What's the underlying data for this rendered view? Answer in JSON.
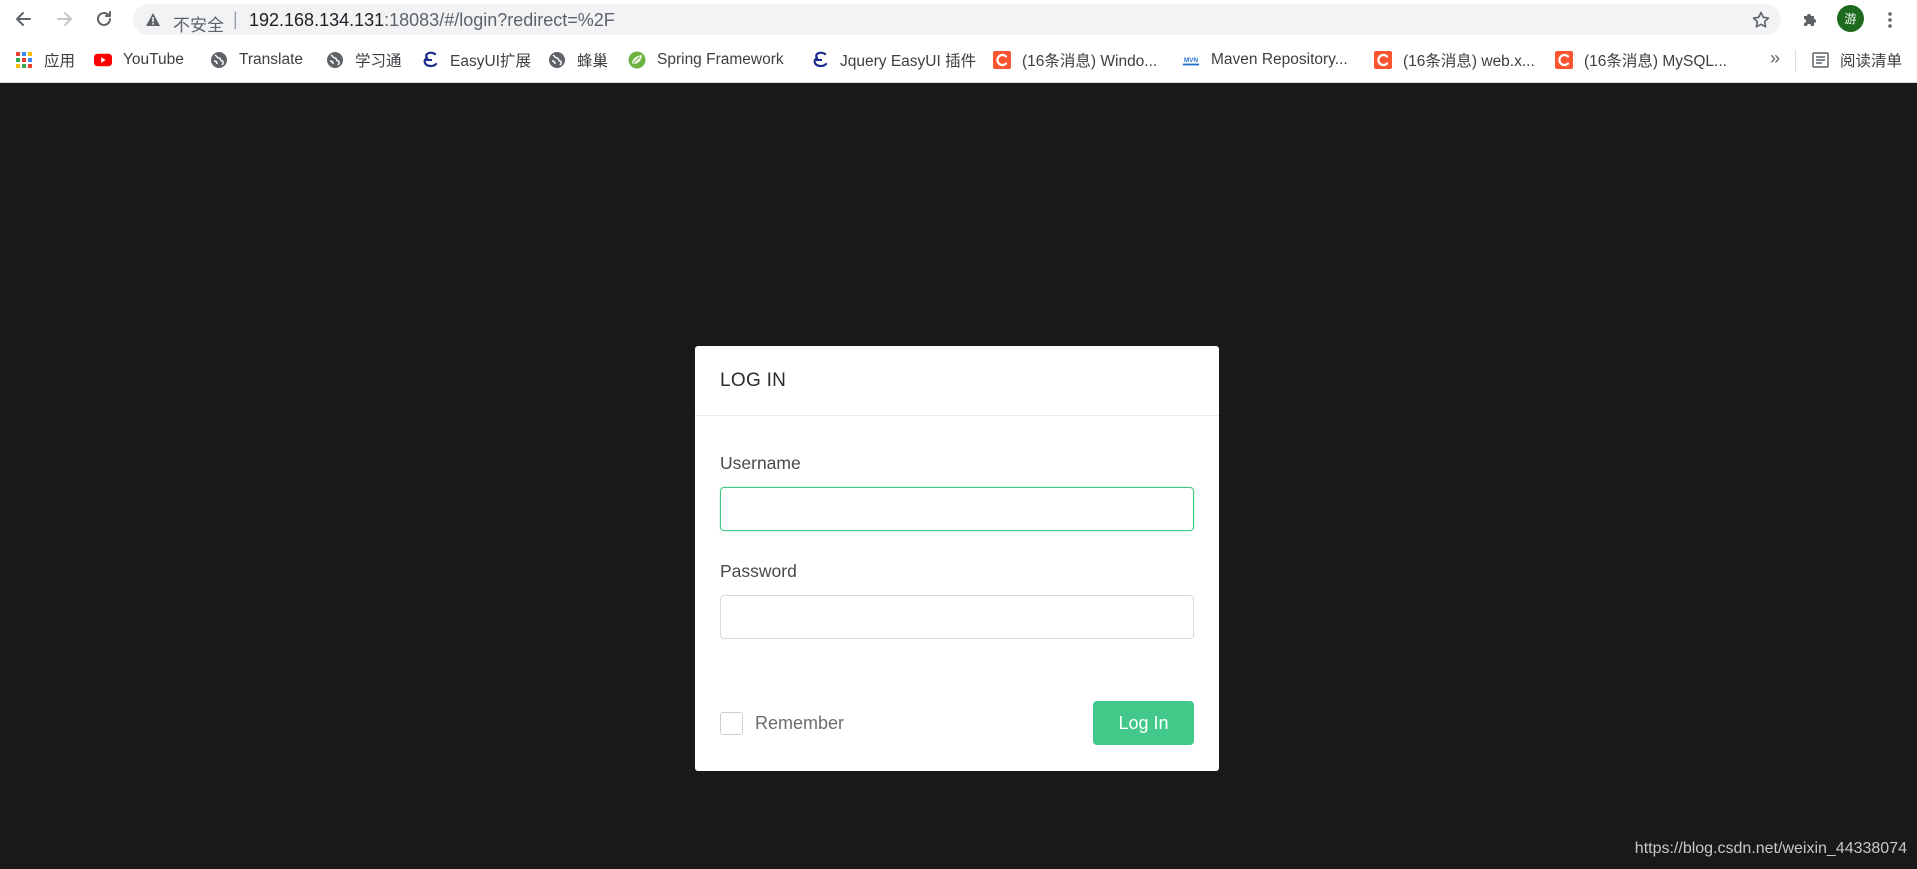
{
  "browser": {
    "security_label": "不安全",
    "separator": "|",
    "url_host": "192.168.134.131",
    "url_rest": ":18083/#/login?redirect=%2F",
    "profile_initial": "游"
  },
  "bookmarks": {
    "items": [
      {
        "label": "应用",
        "icon": "apps-grid-icon"
      },
      {
        "label": "YouTube",
        "icon": "youtube-icon"
      },
      {
        "label": "Translate",
        "icon": "globe-icon"
      },
      {
        "label": "学习通",
        "icon": "globe-icon"
      },
      {
        "label": "EasyUI扩展",
        "icon": "easyui-icon"
      },
      {
        "label": "蜂巢",
        "icon": "globe-icon"
      },
      {
        "label": "Spring Framework",
        "icon": "spring-leaf-icon"
      },
      {
        "label": "Jquery EasyUI 插件",
        "icon": "easyui-icon"
      },
      {
        "label": "(16条消息) Windo...",
        "icon": "csdn-icon"
      },
      {
        "label": "Maven Repository...",
        "icon": "maven-icon"
      },
      {
        "label": "(16条消息) web.x...",
        "icon": "csdn-icon"
      },
      {
        "label": "(16条消息) MySQL...",
        "icon": "csdn-icon"
      }
    ],
    "overflow": "»",
    "reading_list": "阅读清单"
  },
  "login": {
    "title": "LOG IN",
    "username_label": "Username",
    "password_label": "Password",
    "remember_label": "Remember",
    "submit_label": "Log In"
  },
  "colors": {
    "page_background": "#191919",
    "accent": "#42c98a"
  },
  "watermark": "https://blog.csdn.net/weixin_44338074"
}
